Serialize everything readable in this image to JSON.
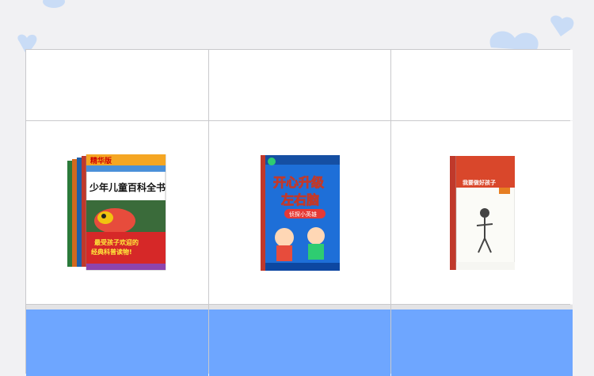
{
  "products": [
    {
      "badge": "精华版",
      "title": "少年儿童百科全书",
      "tagline_line1": "最受孩子欢迎的",
      "tagline_line2": "经典科普读物!"
    },
    {
      "title_line1": "开心升级",
      "title_line2": "左右脑",
      "subtitle": "侦探小英雄"
    },
    {
      "title": "我要做好孩子"
    }
  ],
  "colors": {
    "grid_line": "#c9c9cc",
    "bottom_band": "#6ea6ff",
    "background": "#f1f1f3",
    "heart": "#c9dcf6"
  }
}
